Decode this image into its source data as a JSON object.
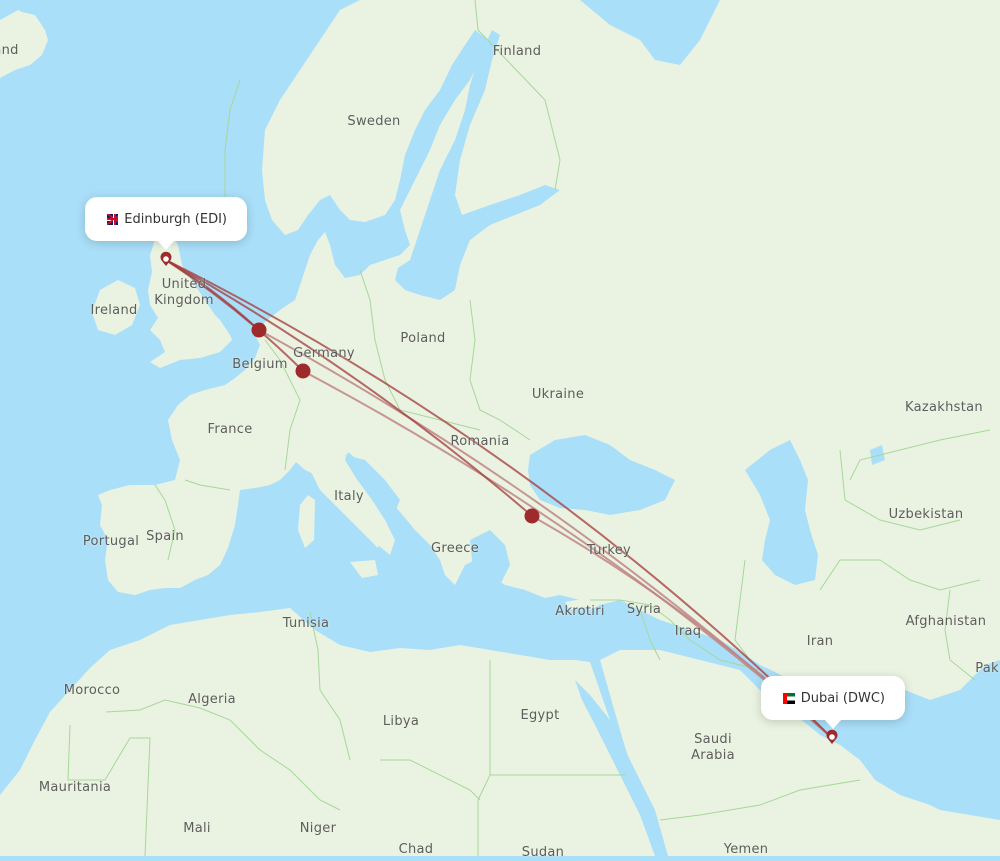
{
  "map": {
    "colors": {
      "water": "#aadff9",
      "land": "#eaf3e1",
      "border": "#a6d79a",
      "route": "#a33a3a",
      "route_light": "#c08585",
      "stop_marker": "#9e2a2b"
    },
    "origin": {
      "city": "Edinburgh",
      "code": "EDI",
      "label": "Edinburgh (EDI)",
      "flag": "uk-flag"
    },
    "destination": {
      "city": "Dubai",
      "code": "DWC",
      "label": "Dubai (DWC)",
      "flag": "uae-flag"
    },
    "stopovers": [
      {
        "name": "Amsterdam"
      },
      {
        "name": "Frankfurt"
      },
      {
        "name": "Istanbul"
      }
    ],
    "routes": [
      {
        "from": "EDI",
        "via": "Amsterdam",
        "to": "DWC"
      },
      {
        "from": "EDI",
        "via": "Frankfurt",
        "to": "DWC"
      },
      {
        "from": "EDI",
        "via": "Istanbul",
        "to": "DWC"
      },
      {
        "from": "EDI",
        "via": null,
        "to": "DWC"
      }
    ],
    "country_labels": [
      {
        "id": "iceland",
        "text": "and"
      },
      {
        "id": "finland",
        "text": "Finland"
      },
      {
        "id": "sweden",
        "text": "Sweden"
      },
      {
        "id": "united-kingdom",
        "text": "United\nKingdom"
      },
      {
        "id": "ireland",
        "text": "Ireland"
      },
      {
        "id": "poland",
        "text": "Poland"
      },
      {
        "id": "germany",
        "text": "Germany"
      },
      {
        "id": "belgium",
        "text": "Belgium"
      },
      {
        "id": "ukraine",
        "text": "Ukraine"
      },
      {
        "id": "kazakhstan",
        "text": "Kazakhstan"
      },
      {
        "id": "france",
        "text": "France"
      },
      {
        "id": "romania",
        "text": "Romania"
      },
      {
        "id": "italy",
        "text": "Italy"
      },
      {
        "id": "uzbekistan",
        "text": "Uzbekistan"
      },
      {
        "id": "portugal",
        "text": "Portugal"
      },
      {
        "id": "spain",
        "text": "Spain"
      },
      {
        "id": "greece",
        "text": "Greece"
      },
      {
        "id": "turkey",
        "text": "Turkey"
      },
      {
        "id": "syria",
        "text": "Syria"
      },
      {
        "id": "akrotiri",
        "text": "Akrotiri"
      },
      {
        "id": "tunisia",
        "text": "Tunisia"
      },
      {
        "id": "iraq",
        "text": "Iraq"
      },
      {
        "id": "iran",
        "text": "Iran"
      },
      {
        "id": "afghanistan",
        "text": "Afghanistan"
      },
      {
        "id": "pakistan",
        "text": "Paki"
      },
      {
        "id": "morocco",
        "text": "Morocco"
      },
      {
        "id": "algeria",
        "text": "Algeria"
      },
      {
        "id": "libya",
        "text": "Libya"
      },
      {
        "id": "egypt",
        "text": "Egypt"
      },
      {
        "id": "saudi-arabia",
        "text": "Saudi\nArabia"
      },
      {
        "id": "mauritania",
        "text": "Mauritania"
      },
      {
        "id": "mali",
        "text": "Mali"
      },
      {
        "id": "niger",
        "text": "Niger"
      },
      {
        "id": "chad",
        "text": "Chad"
      },
      {
        "id": "sudan",
        "text": "Sudan"
      },
      {
        "id": "yemen",
        "text": "Yemen"
      }
    ]
  }
}
